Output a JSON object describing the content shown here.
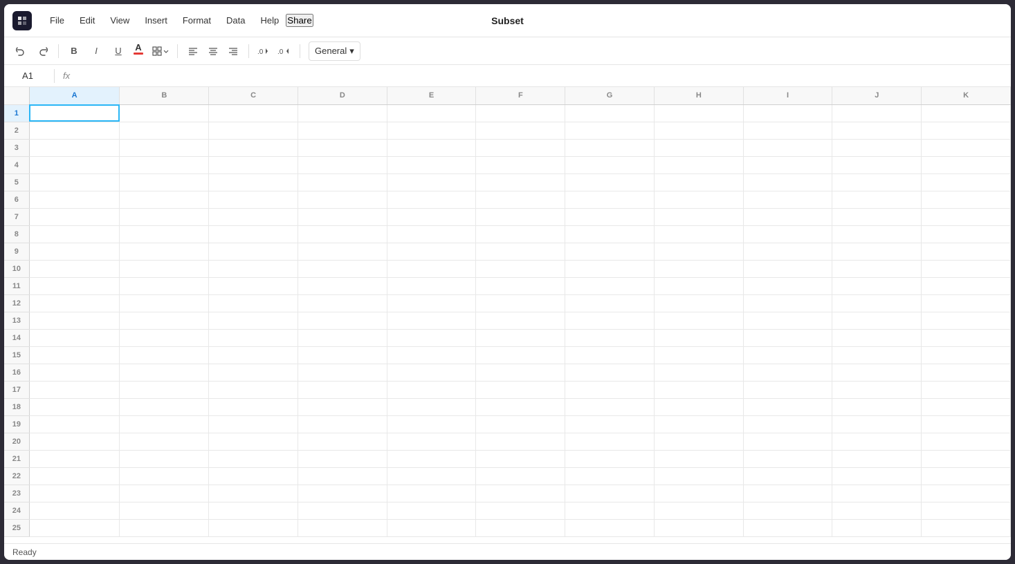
{
  "titleBar": {
    "title": "Subset",
    "shareLabel": "Share",
    "menu": [
      "File",
      "Edit",
      "View",
      "Insert",
      "Format",
      "Data",
      "Help"
    ]
  },
  "toolbar": {
    "undoLabel": "↩",
    "redoLabel": "↪",
    "boldLabel": "B",
    "italicLabel": "I",
    "underlineLabel": "U",
    "fontColorLetter": "A",
    "borderIcon": "⊞",
    "alignLeft": "≡",
    "alignCenter": "≡",
    "alignRight": "≡",
    "decimalDecrease": "←.0",
    "decimalIncrease": ".0→",
    "formatLabel": "General",
    "formatDropdown": "▾"
  },
  "formulaBar": {
    "cellRef": "A1",
    "fxLabel": "fx"
  },
  "grid": {
    "columns": [
      "A",
      "B",
      "C",
      "D",
      "E",
      "F",
      "G",
      "H",
      "I",
      "J",
      "K"
    ],
    "rows": 25,
    "activeCell": "A1"
  },
  "statusBar": {
    "status": "Ready"
  }
}
